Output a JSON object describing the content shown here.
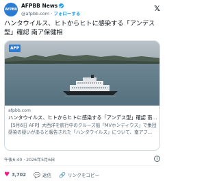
{
  "header": {
    "avatar_text": "AFPBB",
    "account_name": "AFPBB News",
    "handle": "@afpbb.com",
    "separator": "·",
    "follow_label": "フォローする",
    "x_logo": "𝕏"
  },
  "tweet": {
    "text": "ハンタウイルス、ヒトからヒトに感染する「アンデス型」確認 南ア保健相"
  },
  "card": {
    "image_logo": "AFP",
    "domain": "afpbb.com",
    "title": "ハンタウイルス、ヒトからヒトに感染する「アンデス型」確認 南ア保...",
    "description": "【5月6日 AFP】大西洋を航行中のクルーズ船「MVホンディウス」で集団感染の疑いがあると報告された「ハンタウイルス」について、南アフ..."
  },
  "meta": {
    "timestamp": "午後6:40 · 2026年5月6日",
    "info_icon": "i"
  },
  "actions": {
    "like_count": "3,702",
    "reply_label": "返信",
    "link_label": "リンクをコピー"
  },
  "colors": {
    "accent": "#1d9bf0",
    "heart": "#f91880",
    "brand": "#2a7bd3"
  },
  "icons": {
    "verified": "verified-badge-icon",
    "heart": "heart-icon",
    "reply": "reply-icon",
    "link": "link-icon"
  }
}
